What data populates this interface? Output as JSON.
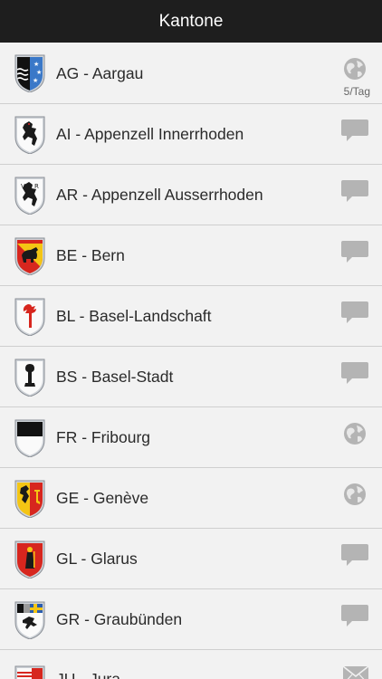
{
  "nav": {
    "title": "Kantone"
  },
  "cantons": [
    {
      "label": "AG - Aargau",
      "action": "globe-icon",
      "rate": "5/Tag"
    },
    {
      "label": "AI - Appenzell Innerrhoden",
      "action": "comment-icon"
    },
    {
      "label": "AR - Appenzell Ausserrhoden",
      "action": "comment-icon"
    },
    {
      "label": "BE - Bern",
      "action": "comment-icon"
    },
    {
      "label": "BL - Basel-Landschaft",
      "action": "comment-icon"
    },
    {
      "label": "BS - Basel-Stadt",
      "action": "comment-icon"
    },
    {
      "label": "FR - Fribourg",
      "action": "globe-icon"
    },
    {
      "label": "GE - Genève",
      "action": "globe-icon"
    },
    {
      "label": "GL - Glarus",
      "action": "comment-icon"
    },
    {
      "label": "GR - Graubünden",
      "action": "comment-icon"
    },
    {
      "label": "JU - Jura",
      "action": "mail-icon"
    }
  ],
  "colors": {
    "nav_bg": "#1e1e1e",
    "row_bg": "#f2f2f2",
    "icon_gray": "#a8a8a8"
  }
}
